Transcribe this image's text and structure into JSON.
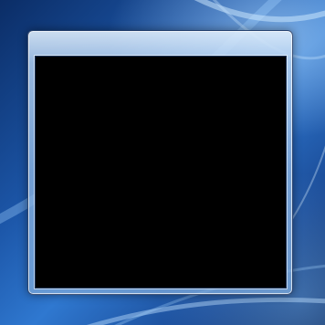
{
  "desktop": {
    "background_color": "#1c56a8",
    "accent_color": "#2f78d0"
  },
  "window": {
    "frame_color": "#a9c8ec",
    "content_color": "#000000"
  }
}
